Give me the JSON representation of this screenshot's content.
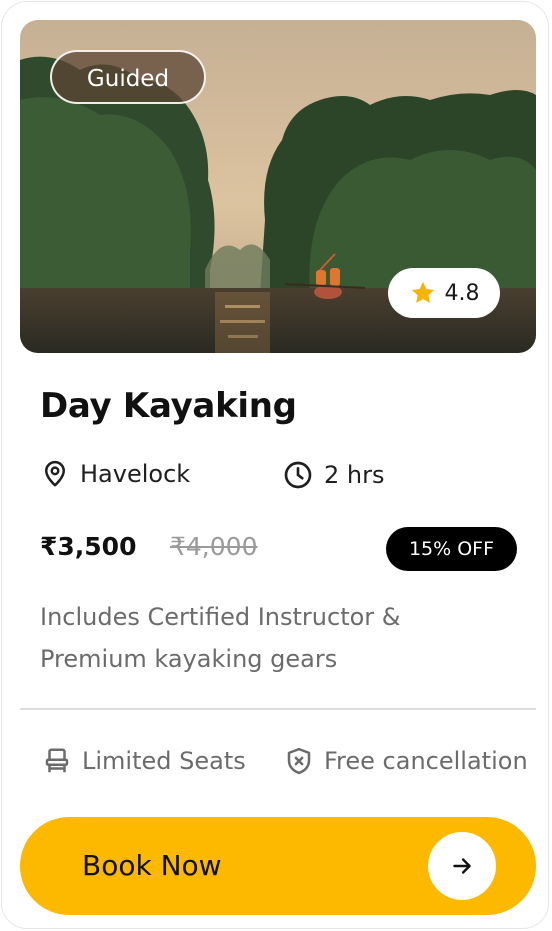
{
  "hero": {
    "tag": "Guided",
    "rating": "4.8",
    "image_alt": "Kayakers paddling through mangroves at sunset"
  },
  "title": "Day Kayaking",
  "meta": {
    "location": "Havelock",
    "duration": "2 hrs"
  },
  "pricing": {
    "price": "₹3,500",
    "original_price": "₹4,000",
    "discount": "15% OFF"
  },
  "description": "Includes Certified Instructor & Premium kayaking gears",
  "features": {
    "seats": "Limited Seats",
    "cancellation": "Free cancellation"
  },
  "cta": {
    "label": "Book Now"
  },
  "colors": {
    "accent": "#fcb900",
    "star": "#f5b400",
    "badge_dark": "#000000"
  }
}
